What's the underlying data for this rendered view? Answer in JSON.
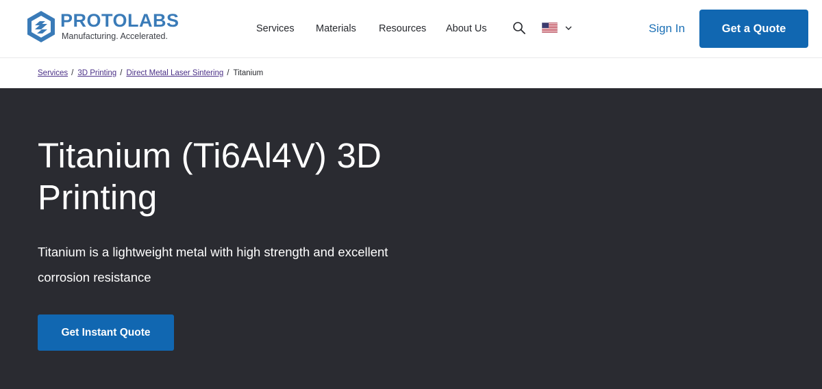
{
  "header": {
    "logo": {
      "name": "PROTOLABS",
      "tagline": "Manufacturing. Accelerated."
    },
    "nav": [
      {
        "label": "Services"
      },
      {
        "label": "Materials"
      },
      {
        "label": "Resources"
      },
      {
        "label": "About Us"
      }
    ],
    "icons": {
      "search": "search-icon",
      "locale": "us-flag-icon",
      "dropdown": "chevron-down-icon"
    },
    "sign_in_label": "Sign In",
    "quote_label": "Get a Quote"
  },
  "breadcrumb": {
    "items": [
      {
        "label": "Services"
      },
      {
        "label": "3D Printing"
      },
      {
        "label": "Direct Metal Laser Sintering"
      }
    ],
    "separator": "/",
    "current": "Titanium"
  },
  "hero": {
    "title": "Titanium (Ti6Al4V) 3D Printing",
    "description": "Titanium is a lightweight metal with high strength and excellent corrosion resistance",
    "cta_label": "Get Instant Quote"
  },
  "colors": {
    "brand_blue": "#1167b1",
    "logo_blue": "#3a7bb8",
    "hero_background": "#2a2b31",
    "breadcrumb_link": "#4a2f86"
  }
}
